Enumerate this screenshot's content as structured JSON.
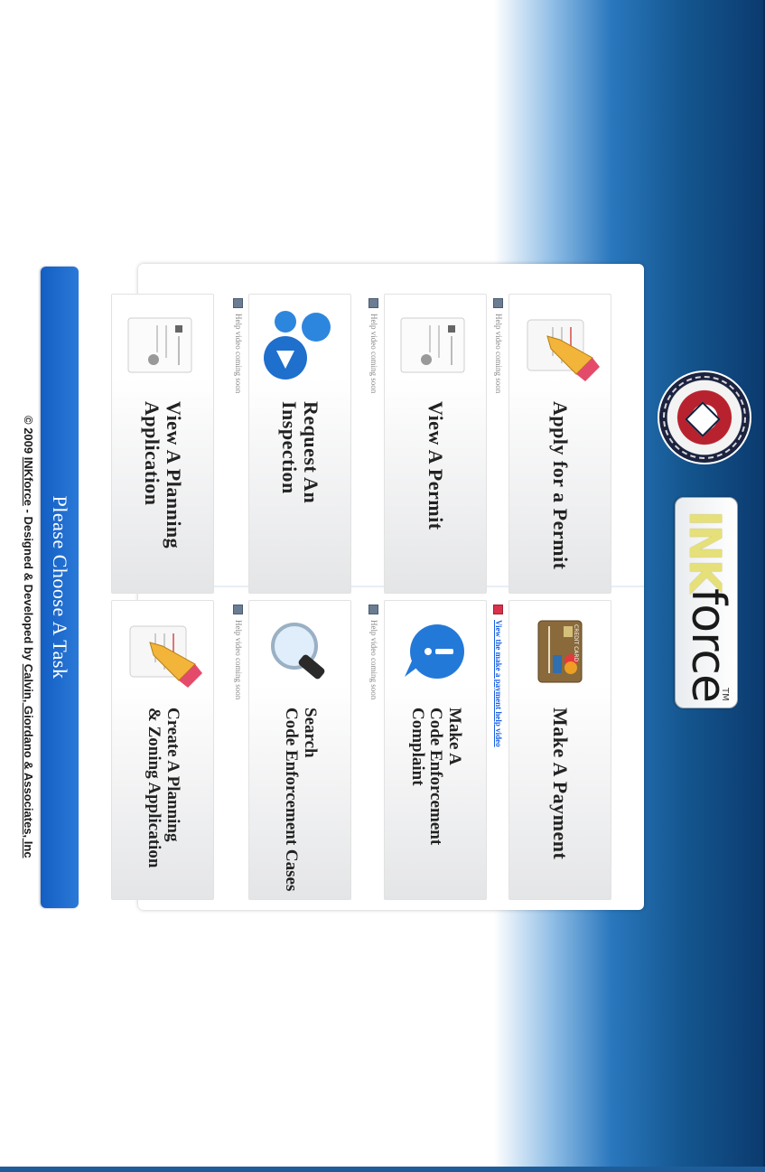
{
  "logo": {
    "ink": "INK",
    "force": "force",
    "tm": "TM"
  },
  "tasks": [
    {
      "title": "Apply for a Permit",
      "help": "Help video coming soon"
    },
    {
      "title": "View A Permit",
      "help": "Help video coming soon"
    },
    {
      "title": "Request An\nInspection",
      "help": "Help video coming soon"
    },
    {
      "title": "View A Planning\nApplication",
      "help": ""
    },
    {
      "title": "Make A Payment",
      "help": "View the make a payment help video"
    },
    {
      "title": "Make A\nCode Enforcement\nComplaint",
      "help": "Help video coming soon"
    },
    {
      "title": "Search\nCode Enforcement Cases",
      "help": "Help video coming soon"
    },
    {
      "title": "Create A Planning\n& Zoning Application",
      "help": ""
    }
  ],
  "choose_label": "Please Choose A Task",
  "footer": {
    "prefix": "© 2009 ",
    "brand": "INKforce",
    "middle": " - Designed & Developed by ",
    "company": "Calvin, Giordano & Associates, Inc",
    "tail": ""
  },
  "card_icon": {
    "front": "CREDIT CARD"
  },
  "colors": {
    "accent": "#1a66cc",
    "header_dark": "#0b3a6e",
    "link": "#1a5fe3"
  }
}
